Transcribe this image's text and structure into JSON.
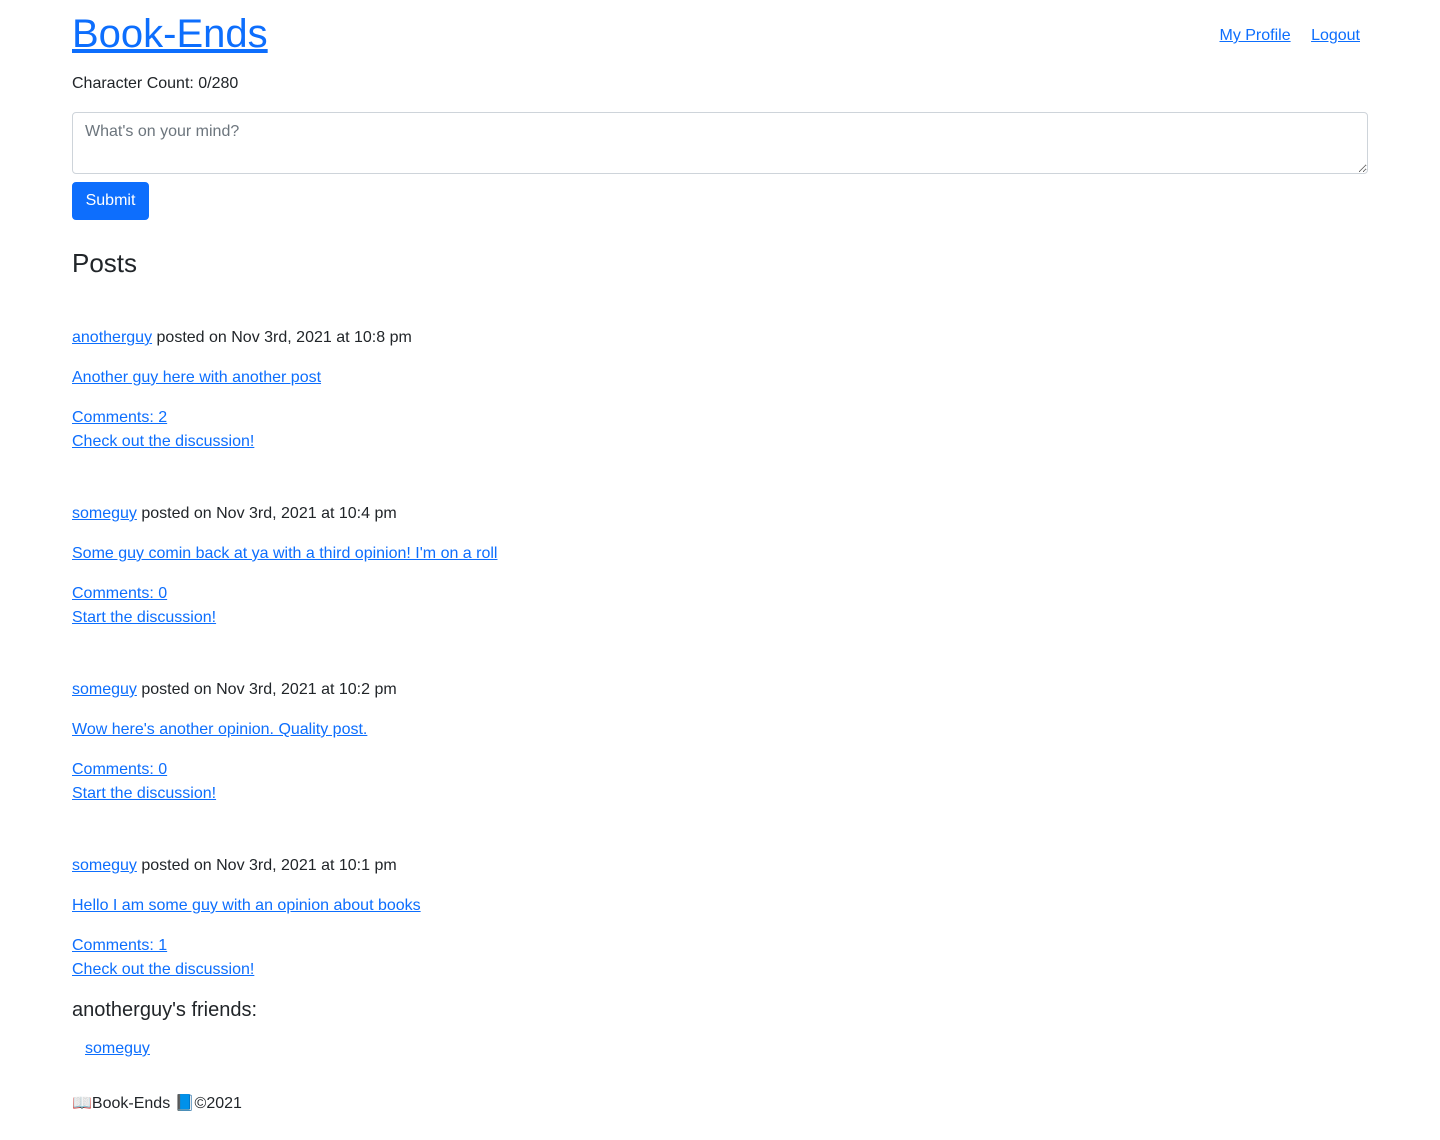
{
  "header": {
    "brand": "Book-Ends",
    "nav": {
      "my_profile": "My Profile",
      "logout": "Logout"
    }
  },
  "composer": {
    "character_count": "Character Count: 0/280",
    "placeholder": "What's on your mind?",
    "submit_label": "Submit"
  },
  "posts_heading": "Posts",
  "posted_on_text": "posted on",
  "posts": [
    {
      "author": "anotherguy",
      "date": "Nov 3rd, 2021 at 10:8 pm",
      "body": "Another guy here with another post",
      "comments": "Comments: 2",
      "discussion": "Check out the discussion!"
    },
    {
      "author": "someguy",
      "date": "Nov 3rd, 2021 at 10:4 pm",
      "body": "Some guy comin back at ya with a third opinion! I'm on a roll",
      "comments": "Comments: 0",
      "discussion": "Start the discussion!"
    },
    {
      "author": "someguy",
      "date": "Nov 3rd, 2021 at 10:2 pm",
      "body": "Wow here's another opinion. Quality post.",
      "comments": "Comments: 0",
      "discussion": "Start the discussion!"
    },
    {
      "author": "someguy",
      "date": "Nov 3rd, 2021 at 10:1 pm",
      "body": "Hello I am some guy with an opinion about books",
      "comments": "Comments: 1",
      "discussion": "Check out the discussion!"
    }
  ],
  "friends": {
    "heading": "anotherguy's friends:",
    "items": [
      "someguy"
    ]
  },
  "footer": {
    "text": "📖Book-Ends 📘©2021"
  }
}
